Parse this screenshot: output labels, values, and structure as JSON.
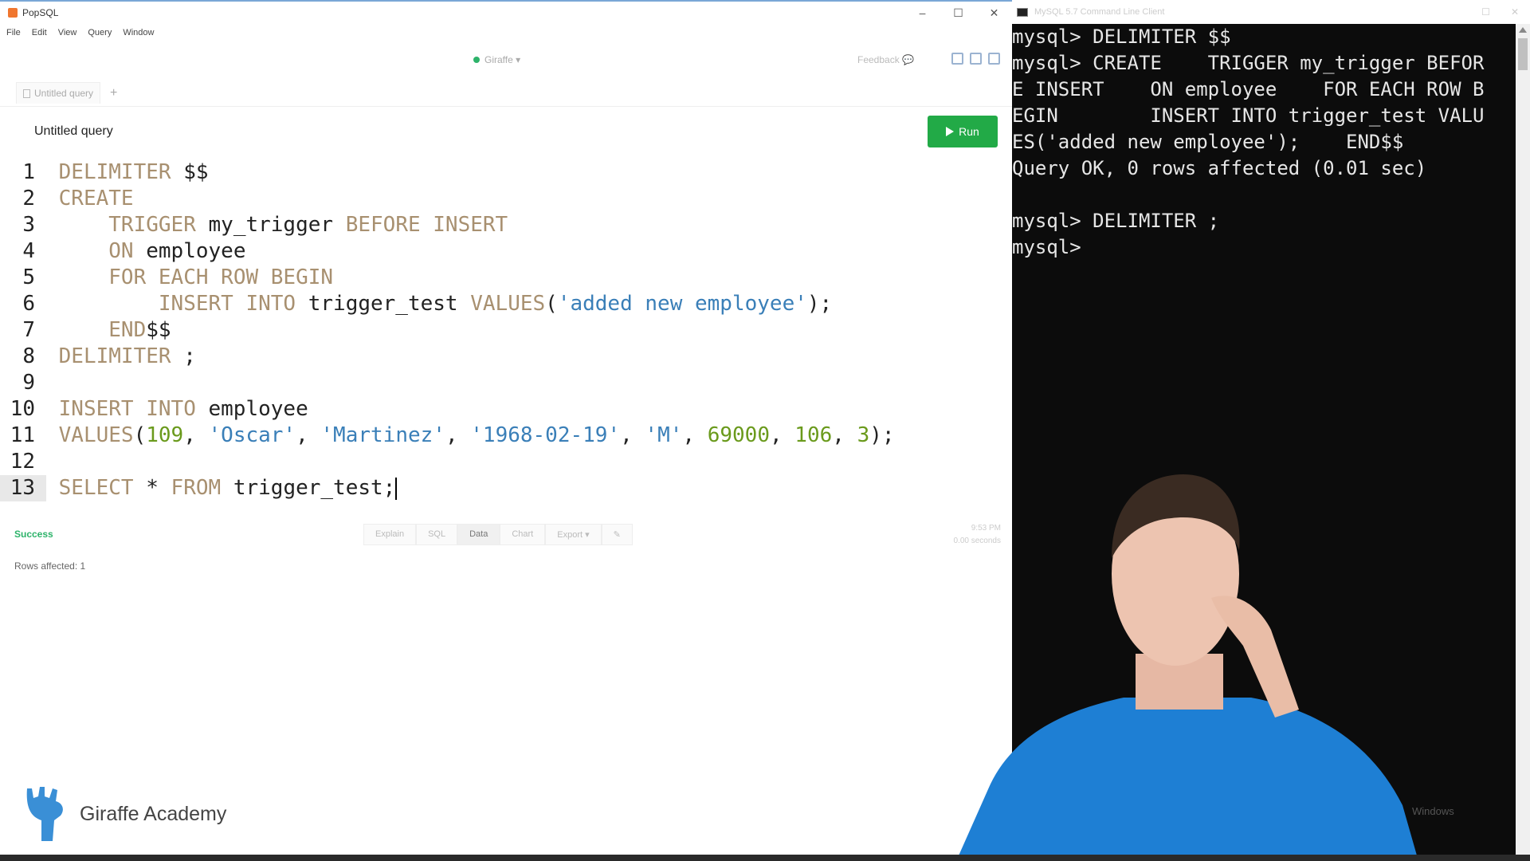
{
  "popsql": {
    "app_title": "PopSQL",
    "menu": [
      "File",
      "Edit",
      "View",
      "Query",
      "Window"
    ],
    "connection": "Giraffe ▾",
    "feedback": "Feedback",
    "tab_label": "Untitled query",
    "tab_add": "+",
    "query_title": "Untitled query",
    "run_label": "Run",
    "status": "Success",
    "result_tabs": [
      "Explain",
      "SQL",
      "Data",
      "Chart",
      "Export ▾",
      "✎"
    ],
    "run_time": "9:53 PM",
    "run_duration": "0.00 seconds",
    "rows_affected": "Rows affected: 1"
  },
  "editor": {
    "lines": [
      {
        "num": "1",
        "segments": [
          {
            "t": "DELIMITER",
            "c": "kw"
          },
          {
            "t": " $$",
            "c": ""
          }
        ]
      },
      {
        "num": "2",
        "segments": [
          {
            "t": "CREATE",
            "c": "kw"
          }
        ]
      },
      {
        "num": "3",
        "segments": [
          {
            "t": "    ",
            "c": ""
          },
          {
            "t": "TRIGGER",
            "c": "kw"
          },
          {
            "t": " my_trigger ",
            "c": ""
          },
          {
            "t": "BEFORE INSERT",
            "c": "kw"
          }
        ]
      },
      {
        "num": "4",
        "segments": [
          {
            "t": "    ",
            "c": ""
          },
          {
            "t": "ON",
            "c": "kw"
          },
          {
            "t": " employee",
            "c": ""
          }
        ]
      },
      {
        "num": "5",
        "segments": [
          {
            "t": "    ",
            "c": ""
          },
          {
            "t": "FOR EACH ROW BEGIN",
            "c": "kw"
          }
        ]
      },
      {
        "num": "6",
        "segments": [
          {
            "t": "        ",
            "c": ""
          },
          {
            "t": "INSERT INTO",
            "c": "kw"
          },
          {
            "t": " trigger_test ",
            "c": ""
          },
          {
            "t": "VALUES",
            "c": "kw"
          },
          {
            "t": "(",
            "c": ""
          },
          {
            "t": "'added new employee'",
            "c": "str"
          },
          {
            "t": ");",
            "c": ""
          }
        ]
      },
      {
        "num": "7",
        "segments": [
          {
            "t": "    ",
            "c": ""
          },
          {
            "t": "END",
            "c": "kw"
          },
          {
            "t": "$$",
            "c": ""
          }
        ]
      },
      {
        "num": "8",
        "segments": [
          {
            "t": "DELIMITER",
            "c": "kw"
          },
          {
            "t": " ;",
            "c": ""
          }
        ]
      },
      {
        "num": "9",
        "segments": []
      },
      {
        "num": "10",
        "segments": [
          {
            "t": "INSERT INTO",
            "c": "kw"
          },
          {
            "t": " employee",
            "c": ""
          }
        ]
      },
      {
        "num": "11",
        "segments": [
          {
            "t": "VALUES",
            "c": "kw"
          },
          {
            "t": "(",
            "c": ""
          },
          {
            "t": "109",
            "c": "num"
          },
          {
            "t": ", ",
            "c": ""
          },
          {
            "t": "'Oscar'",
            "c": "str"
          },
          {
            "t": ", ",
            "c": ""
          },
          {
            "t": "'Martinez'",
            "c": "str"
          },
          {
            "t": ", ",
            "c": ""
          },
          {
            "t": "'1968-02-19'",
            "c": "str"
          },
          {
            "t": ", ",
            "c": ""
          },
          {
            "t": "'M'",
            "c": "str"
          },
          {
            "t": ", ",
            "c": ""
          },
          {
            "t": "69000",
            "c": "num"
          },
          {
            "t": ", ",
            "c": ""
          },
          {
            "t": "106",
            "c": "num"
          },
          {
            "t": ", ",
            "c": ""
          },
          {
            "t": "3",
            "c": "num"
          },
          {
            "t": ");",
            "c": ""
          }
        ]
      },
      {
        "num": "12",
        "segments": []
      },
      {
        "num": "13",
        "segments": [
          {
            "t": "SELECT",
            "c": "kw"
          },
          {
            "t": " * ",
            "c": ""
          },
          {
            "t": "FROM",
            "c": "kw"
          },
          {
            "t": " trigger_test;",
            "c": ""
          }
        ],
        "active": true
      }
    ]
  },
  "terminal": {
    "title": "MySQL 5.7 Command Line Client",
    "lines": [
      "mysql> DELIMITER $$",
      "mysql> CREATE    TRIGGER my_trigger BEFOR",
      "E INSERT    ON employee    FOR EACH ROW B",
      "EGIN        INSERT INTO trigger_test VALU",
      "ES('added new employee');    END$$",
      "Query OK, 0 rows affected (0.01 sec)",
      "",
      "mysql> DELIMITER ;",
      "mysql>"
    ]
  },
  "brand": {
    "name": "Giraffe Academy"
  },
  "watermark": "Windows",
  "colors": {
    "run": "#22aa47",
    "keyword": "#a89070",
    "string": "#3a7fb8",
    "number": "#6a9a1c",
    "success": "#2db36a"
  }
}
